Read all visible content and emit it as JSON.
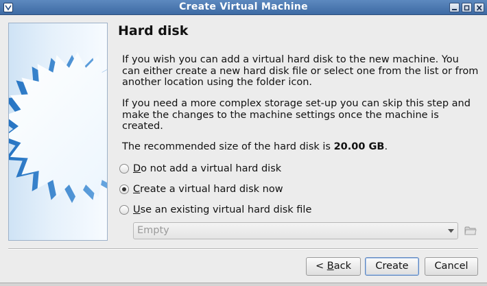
{
  "window": {
    "title": "Create Virtual Machine"
  },
  "page": {
    "title": "Hard disk",
    "paragraph1": "If you wish you can add a virtual hard disk to the new machine. You can either create a new hard disk file or select one from the list or from another location using the folder icon.",
    "paragraph2": "If you need a more complex storage set-up you can skip this step and make the changes to the machine settings once the machine is created.",
    "recommended_prefix": "The recommended size of the hard disk is ",
    "recommended_size": "20.00 GB",
    "recommended_suffix": "."
  },
  "options": [
    {
      "mnemonic": "D",
      "rest": "o not add a virtual hard disk",
      "checked": false
    },
    {
      "mnemonic": "C",
      "rest": "reate a virtual hard disk now",
      "checked": true
    },
    {
      "mnemonic": "U",
      "rest": "se an existing virtual hard disk file",
      "checked": false
    }
  ],
  "existing_disk": {
    "value": "Empty"
  },
  "buttons": {
    "back_prefix": "< ",
    "back_mnemonic": "B",
    "back_rest": "ack",
    "create": "Create",
    "cancel": "Cancel"
  },
  "icons": {
    "window_icon": "virtualbox-icon",
    "minimize": "minimize-icon",
    "maximize": "maximize-icon",
    "close": "close-icon",
    "folder": "folder-icon",
    "combo_arrow": "chevron-down-icon"
  }
}
